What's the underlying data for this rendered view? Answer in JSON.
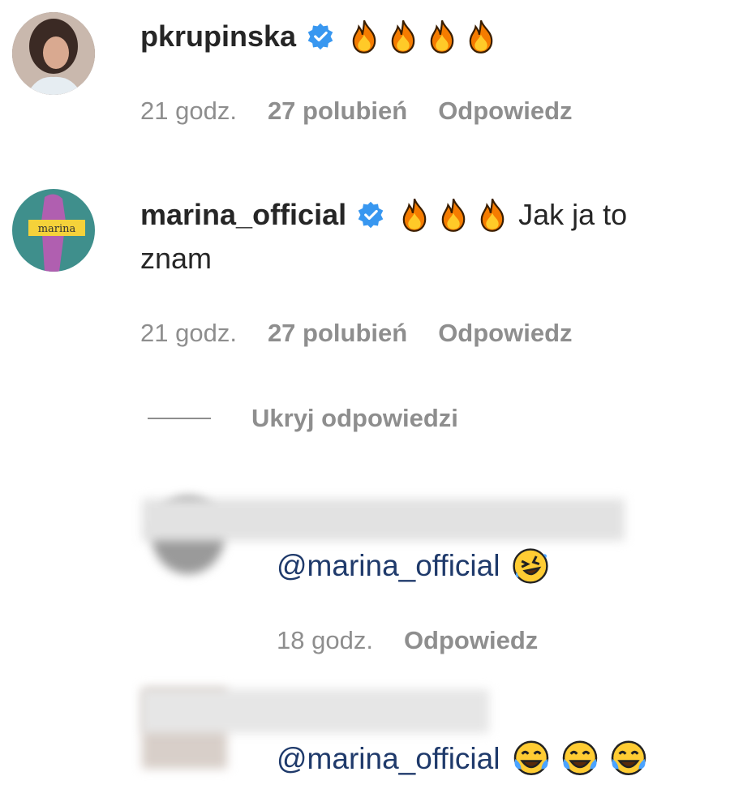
{
  "comments": [
    {
      "username": "pkrupinska",
      "verified": true,
      "emoji": [
        "fire",
        "fire",
        "fire",
        "fire"
      ],
      "time": "21 godz.",
      "likes": "27 polubień",
      "reply_label": "Odpowiedz"
    },
    {
      "username": "marina_official",
      "verified": true,
      "emoji": [
        "fire",
        "fire",
        "fire"
      ],
      "text_line1": "Jak ja to",
      "text_line2": "znam",
      "time": "21 godz.",
      "likes": "27 polubień",
      "reply_label": "Odpowiedz",
      "avatar_label": "marina"
    }
  ],
  "hide_replies_label": "Ukryj odpowiedzi",
  "replies": [
    {
      "mention": "@marina_official",
      "emoji": [
        "rolling-on-floor-laughing"
      ],
      "time": "18 godz.",
      "reply_label": "Odpowiedz"
    },
    {
      "mention": "@marina_official",
      "emoji": [
        "tears-of-joy",
        "tears-of-joy",
        "tears-of-joy"
      ]
    }
  ],
  "colors": {
    "verified_badge": "#3897f0",
    "meta_text": "#8e8e8e",
    "mention": "#1f3a6b"
  }
}
